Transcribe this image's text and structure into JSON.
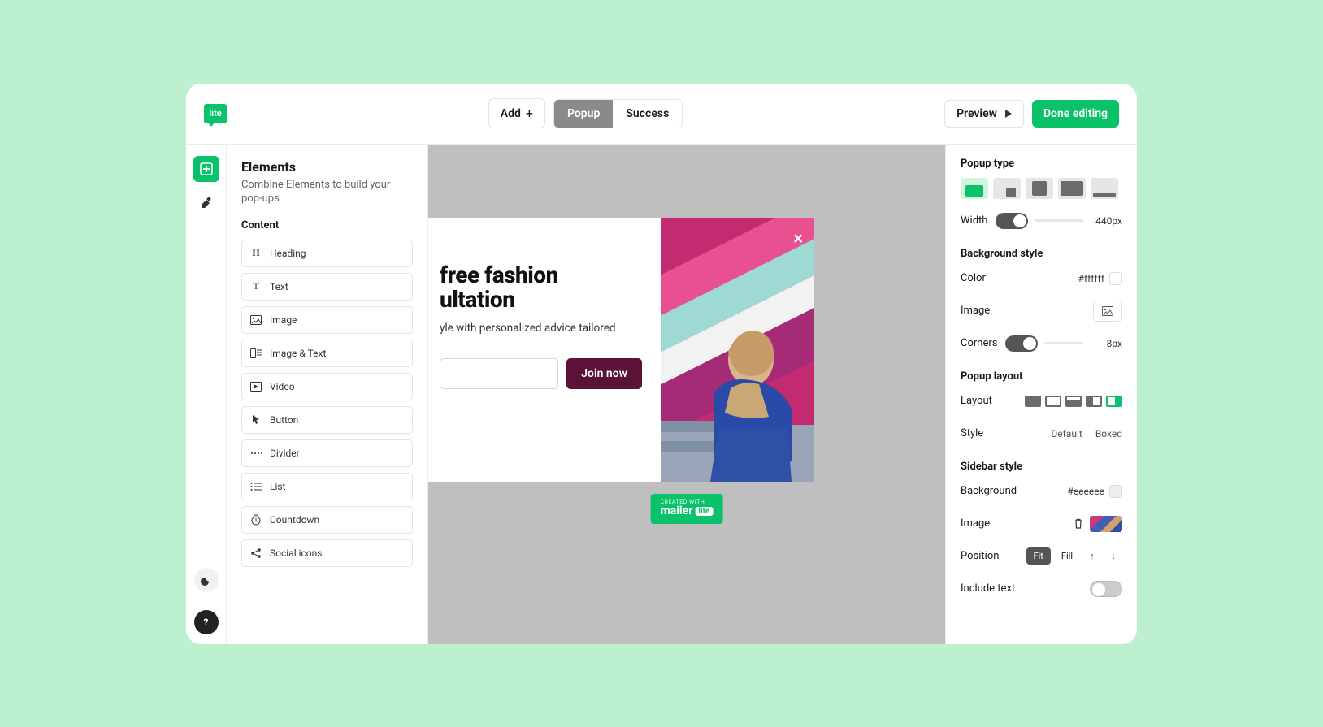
{
  "logo_text": "lite",
  "topbar": {
    "add": "Add",
    "popup": "Popup",
    "success": "Success",
    "preview": "Preview",
    "done": "Done editing"
  },
  "left": {
    "title": "Elements",
    "desc": "Combine Elements to build your pop-ups",
    "section": "Content",
    "items": [
      {
        "label": "Heading",
        "icon": "H"
      },
      {
        "label": "Text",
        "icon": "T"
      },
      {
        "label": "Image",
        "icon": "img"
      },
      {
        "label": "Image & Text",
        "icon": "imgtxt"
      },
      {
        "label": "Video",
        "icon": "video"
      },
      {
        "label": "Button",
        "icon": "cursor"
      },
      {
        "label": "Divider",
        "icon": "divider"
      },
      {
        "label": "List",
        "icon": "list"
      },
      {
        "label": "Countdown",
        "icon": "clock"
      },
      {
        "label": "Social icons",
        "icon": "share"
      }
    ]
  },
  "preview": {
    "heading_part1": "free fashion",
    "heading_part2": "ultation",
    "subtext": "yle with personalized advice tailored",
    "button": "Join now",
    "badge_small": "CREATED WITH",
    "badge_main": "mailer",
    "badge_lite": "lite"
  },
  "right": {
    "popup_type": "Popup type",
    "width_label": "Width",
    "width_value": "440px",
    "bg_style": "Background style",
    "color_label": "Color",
    "color_value": "#ffffff",
    "image_label": "Image",
    "corners_label": "Corners",
    "corners_value": "8px",
    "popup_layout": "Popup layout",
    "layout_label": "Layout",
    "style_label": "Style",
    "style_default": "Default",
    "style_boxed": "Boxed",
    "sidebar_style": "Sidebar style",
    "sb_bg_label": "Background",
    "sb_bg_value": "#eeeeee",
    "sb_image_label": "Image",
    "position_label": "Position",
    "pos_fit": "Fit",
    "pos_fill": "Fill",
    "include_text": "Include text"
  }
}
